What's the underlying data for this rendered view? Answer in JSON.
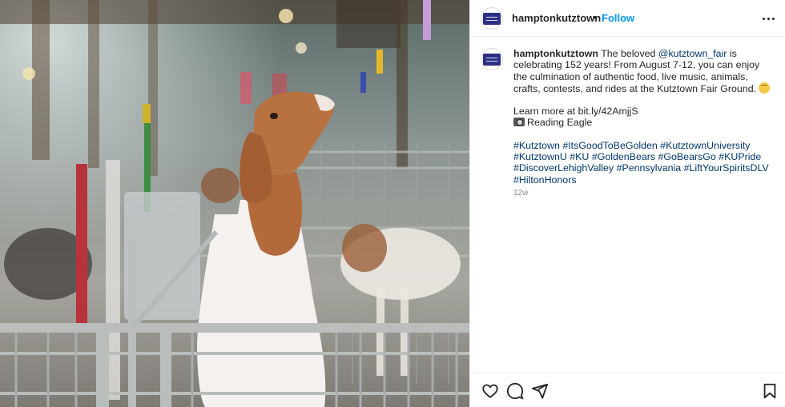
{
  "post": {
    "image_alt": "Goat standing in a pen at the fair",
    "username": "hamptonkutztown",
    "separator": "•",
    "follow_label": "Follow",
    "more_icon": "more-options-icon",
    "caption": {
      "username": "hamptonkutztown",
      "text_1": " The beloved ",
      "mention": "@kutztown_fair",
      "text_2": " is celebrating 152 years! From August 7-12, you can enjoy the culmination of authentic food, live music, animals, crafts, contests, and rides at the Kutztown Fair Ground. ",
      "learn_more": "Learn more at bit.ly/42AmjjS",
      "source": "Reading Eagle",
      "hashtags": [
        "#Kutztown",
        "#ItsGoodToBeGolden",
        "#KutztownUniversity",
        "#KutztownU",
        "#KU",
        "#GoldenBears",
        "#GoBearsGo",
        "#KUPride",
        "#DiscoverLehighValley",
        "#Pennsylvania",
        "#LiftYourSpiritsDLV",
        "#HiltonHonors"
      ]
    },
    "age": "12w",
    "icons": {
      "emoji": "partying-face-emoji",
      "camera": "camera-flash-emoji",
      "like": "heart-icon",
      "comment": "comment-icon",
      "share": "share-icon",
      "save": "bookmark-icon"
    },
    "colors": {
      "link": "#00376b",
      "follow": "#0095f6",
      "brand": "#2b2f84"
    }
  }
}
